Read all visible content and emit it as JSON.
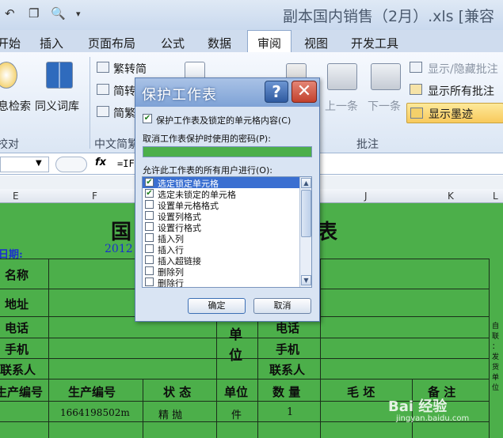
{
  "window": {
    "title": "副本国内销售（2月）.xls  [兼容"
  },
  "tabs": [
    {
      "label": "开始"
    },
    {
      "label": "插入"
    },
    {
      "label": "页面布局"
    },
    {
      "label": "公式"
    },
    {
      "label": "数据"
    },
    {
      "label": "审阅",
      "active": true
    },
    {
      "label": "视图"
    },
    {
      "label": "开发工具"
    }
  ],
  "ribbon": {
    "research_label": "息检索",
    "thesaurus_label": "同义词库",
    "proofing_group": "校对",
    "trad_convert": "繁转简",
    "simp_convert_1": "简转",
    "simp_convert_2": "简繁",
    "chinese_group": "中文简繁",
    "prev_label": "上一条",
    "next_label": "下一条",
    "show_hide_comment": "显示/隐藏批注",
    "show_all_comments": "显示所有批注",
    "show_ink": "显示墨迹",
    "comments_group": "批注"
  },
  "formula_bar": {
    "fx": "fx",
    "formula": "=IF                                    0))"
  },
  "columns": [
    "E",
    "F",
    "J",
    "K",
    "L"
  ],
  "sheet": {
    "title_fragment": "国",
    "title_fragment_right": "表",
    "date_label": "日期:",
    "date_value": "2012",
    "name": "名称",
    "address": "地址",
    "phone": "电话",
    "mobile": "手机",
    "contact": "联系人",
    "unit": "单",
    "unit2": "位",
    "phone_r": "电话",
    "mobile_r": "手机",
    "contact_r": "联系人",
    "hdr_cust_code": "生产编号",
    "hdr_prod_code": "生产编号",
    "hdr_status": "状 态",
    "hdr_unit": "单位",
    "hdr_qty": "数 量",
    "hdr_blank": "毛 坯",
    "hdr_remark": "备 注",
    "row_prod_code": "1664198502m",
    "row_status": "精 抛",
    "row_unit": "件",
    "row_qty": "1",
    "side_note": "自 联 ：发 货 单 位"
  },
  "dialog": {
    "title": "保护工作表",
    "help": "?",
    "close": "✕",
    "protect_label": "保护工作表及锁定的单元格内容(C)",
    "password_label": "取消工作表保护时使用的密码(P):",
    "allow_label": "允许此工作表的所有用户进行(O):",
    "items": [
      {
        "label": "选定锁定单元格",
        "checked": true,
        "selected": true
      },
      {
        "label": "选定未锁定的单元格",
        "checked": true,
        "selected": false
      },
      {
        "label": "设置单元格格式",
        "checked": false,
        "selected": false
      },
      {
        "label": "设置列格式",
        "checked": false,
        "selected": false
      },
      {
        "label": "设置行格式",
        "checked": false,
        "selected": false
      },
      {
        "label": "插入列",
        "checked": false,
        "selected": false
      },
      {
        "label": "插入行",
        "checked": false,
        "selected": false
      },
      {
        "label": "插入超链接",
        "checked": false,
        "selected": false
      },
      {
        "label": "删除列",
        "checked": false,
        "selected": false
      },
      {
        "label": "删除行",
        "checked": false,
        "selected": false
      }
    ],
    "ok": "确定",
    "cancel": "取消"
  },
  "watermark": {
    "brand": "Bai 经验",
    "url": "jingyan.baidu.com"
  },
  "colors": {
    "sheet_green": "#4caf4a",
    "accent_blue": "#3a6fd1"
  }
}
